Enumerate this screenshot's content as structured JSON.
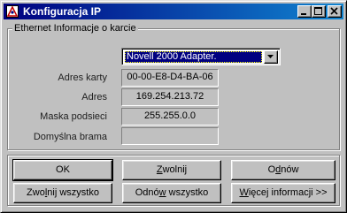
{
  "window": {
    "title": "Konfiguracja IP"
  },
  "titlebar": {
    "app_icon": "ip-config-icon",
    "minimize_icon": "minimize-icon",
    "maximize_icon": "maximize-icon",
    "close_icon": "close-icon"
  },
  "group": {
    "title": "Ethernet  Informacje o karcie"
  },
  "adapter": {
    "selected": "Novell 2000 Adapter.",
    "dropdown_icon": "chevron-down-icon"
  },
  "fields": [
    {
      "label": "Adres karty",
      "value": "00-00-E8-D4-BA-06"
    },
    {
      "label": "Adres",
      "value": "169.254.213.72"
    },
    {
      "label": "Maska podsieci",
      "value": "255.255.0.0"
    },
    {
      "label": "Domyślna brama",
      "value": ""
    }
  ],
  "buttons": {
    "ok": "OK",
    "release": {
      "pre": "",
      "key": "Z",
      "post": "wolnij"
    },
    "renew": {
      "pre": "O",
      "key": "d",
      "post": "nów"
    },
    "release_all": {
      "pre": "Zwo",
      "key": "l",
      "post": "nij wszystko"
    },
    "renew_all": {
      "pre": "Odnó",
      "key": "w",
      "post": " wszystko"
    },
    "more_info": {
      "pre": "",
      "key": "W",
      "post": "ięcej informacji >>"
    }
  }
}
